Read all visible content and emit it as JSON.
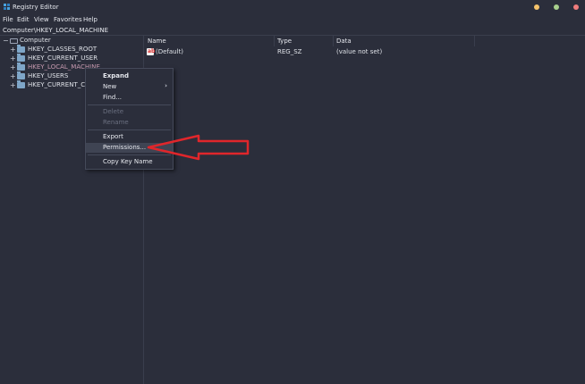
{
  "window": {
    "title": "Registry Editor",
    "app_icon": "registry-editor-icon",
    "controls": [
      {
        "name": "minimize-dot",
        "color": "#f5c36b"
      },
      {
        "name": "maximize-dot",
        "color": "#a8d08d"
      },
      {
        "name": "close-dot",
        "color": "#f07c7c"
      }
    ]
  },
  "menubar": {
    "file": "File",
    "edit": "Edit",
    "view": "View",
    "favorites": "Favorites",
    "help": "Help"
  },
  "address": "Computer\\HKEY_LOCAL_MACHINE",
  "tree": {
    "root": {
      "label": "Computer",
      "expander": "−"
    },
    "items": [
      {
        "label": "HKEY_CLASSES_ROOT",
        "expander": "+",
        "selected": false
      },
      {
        "label": "HKEY_CURRENT_USER",
        "expander": "+",
        "selected": false
      },
      {
        "label": "HKEY_LOCAL_MACHINE",
        "expander": "+",
        "selected": true
      },
      {
        "label": "HKEY_USERS",
        "expander": "+",
        "selected": false
      },
      {
        "label": "HKEY_CURRENT_CON",
        "expander": "+",
        "selected": false
      }
    ]
  },
  "columns": {
    "name": "Name",
    "type": "Type",
    "data": "Data"
  },
  "values": [
    {
      "name": "(Default)",
      "type": "REG_SZ",
      "data": "(value not set)",
      "icon": "string-value-icon",
      "icon_glyph": "ab"
    }
  ],
  "context_menu": {
    "expand": "Expand",
    "new": "New",
    "new_arrow": "›",
    "find": "Find...",
    "delete": "Delete",
    "rename": "Rename",
    "export": "Export",
    "permissions": "Permissions...",
    "copy_key_name": "Copy Key Name"
  },
  "colors": {
    "background": "#2b2e3b",
    "selected_text": "#c79ab0",
    "annotation_arrow": "#e0262b",
    "folder": "#7fa6c8"
  }
}
